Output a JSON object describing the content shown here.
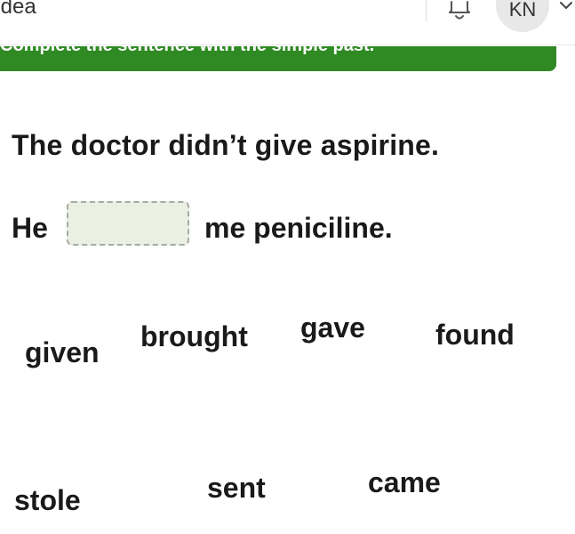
{
  "app": {
    "title": "Idea",
    "avatar_initials": "KN",
    "icons": [
      "bell-icon",
      "chevron-down-icon"
    ]
  },
  "instruction": {
    "text": "Complete the sentence with the simple past."
  },
  "exercise": {
    "prompt": "The doctor didn’t give aspirine.",
    "sentence_before": "He",
    "blank_value": "",
    "sentence_after": "me peniciline."
  },
  "options": [
    "given",
    "brought",
    "gave",
    "found",
    "stole",
    "sent",
    "came"
  ],
  "colors": {
    "banner": "#2f8a23",
    "blank_fill": "#ebf0e3",
    "blank_border": "#a6aba3"
  }
}
